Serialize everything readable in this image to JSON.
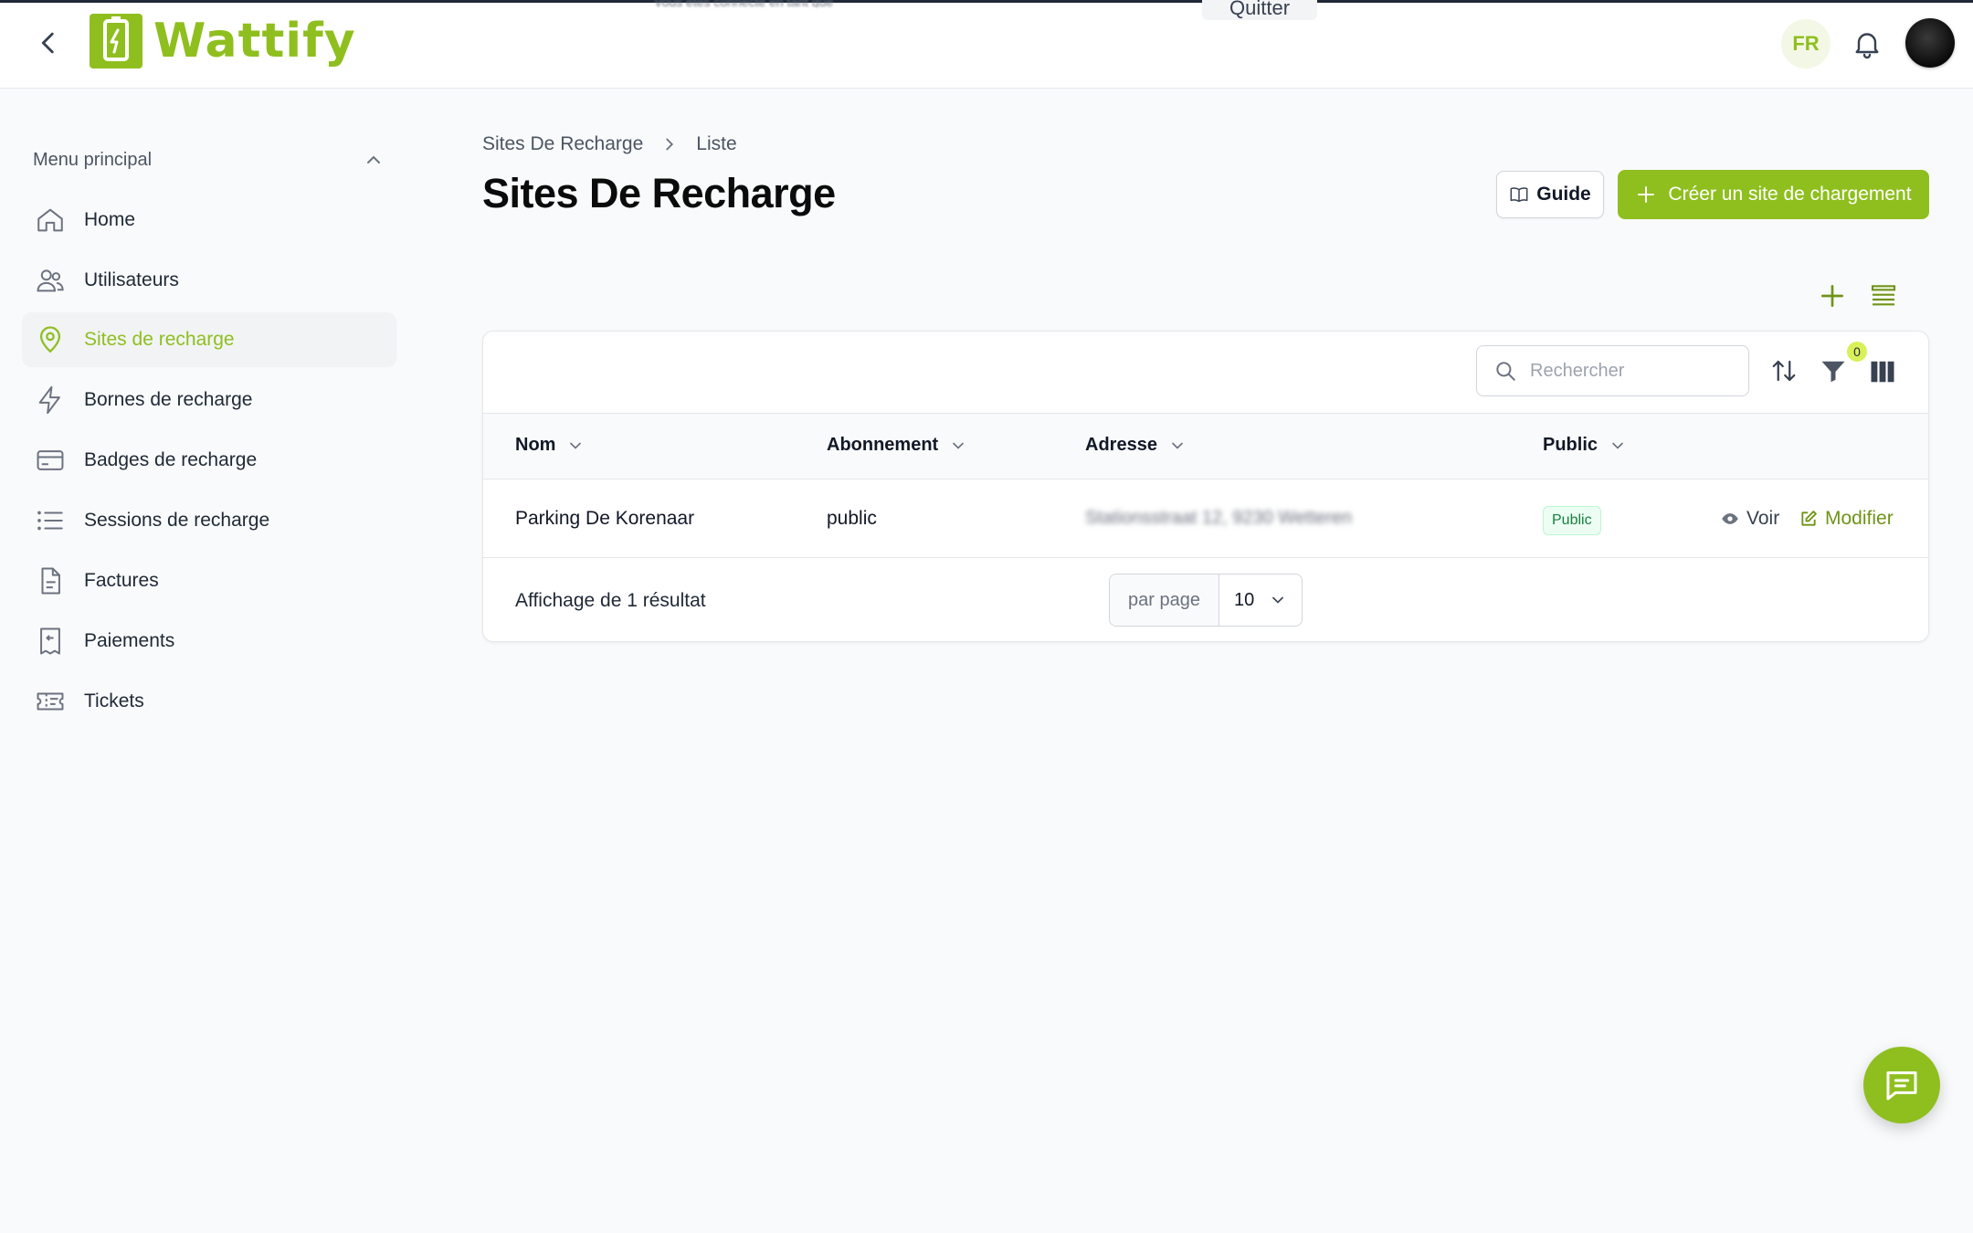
{
  "topbar": {
    "brand": "Wattify",
    "language": "FR",
    "impersonation_banner": "Vous êtes connecté en tant que",
    "quit_label": "Quitter"
  },
  "sidebar": {
    "section_title": "Menu principal",
    "items": [
      {
        "label": "Home",
        "icon": "home-icon",
        "active": false
      },
      {
        "label": "Utilisateurs",
        "icon": "users-icon",
        "active": false
      },
      {
        "label": "Sites de recharge",
        "icon": "map-pin-icon",
        "active": true
      },
      {
        "label": "Bornes de recharge",
        "icon": "bolt-icon",
        "active": false
      },
      {
        "label": "Badges de recharge",
        "icon": "card-icon",
        "active": false
      },
      {
        "label": "Sessions de recharge",
        "icon": "list-icon",
        "active": false
      },
      {
        "label": "Factures",
        "icon": "document-icon",
        "active": false
      },
      {
        "label": "Paiements",
        "icon": "receipt-icon",
        "active": false
      },
      {
        "label": "Tickets",
        "icon": "ticket-icon",
        "active": false
      }
    ]
  },
  "breadcrumb": [
    "Sites De Recharge",
    "Liste"
  ],
  "page_title": "Sites De Recharge",
  "actions": {
    "guide_label": "Guide",
    "create_label": "Créer un site de chargement"
  },
  "table": {
    "search_placeholder": "Rechercher",
    "filter_count": "0",
    "columns": [
      "Nom",
      "Abonnement",
      "Adresse",
      "Public"
    ],
    "rows": [
      {
        "nom": "Parking De Korenaar",
        "abonnement": "public",
        "adresse": "Stationsstraat 12, 9230 Wetteren",
        "public": "Public",
        "view_label": "Voir",
        "edit_label": "Modifier"
      }
    ],
    "results_text": "Affichage de 1 résultat",
    "per_page_label": "par page",
    "per_page_value": "10"
  },
  "colors": {
    "brand_green": "#8fbf1f",
    "active_bg": "#f1f3f5"
  }
}
